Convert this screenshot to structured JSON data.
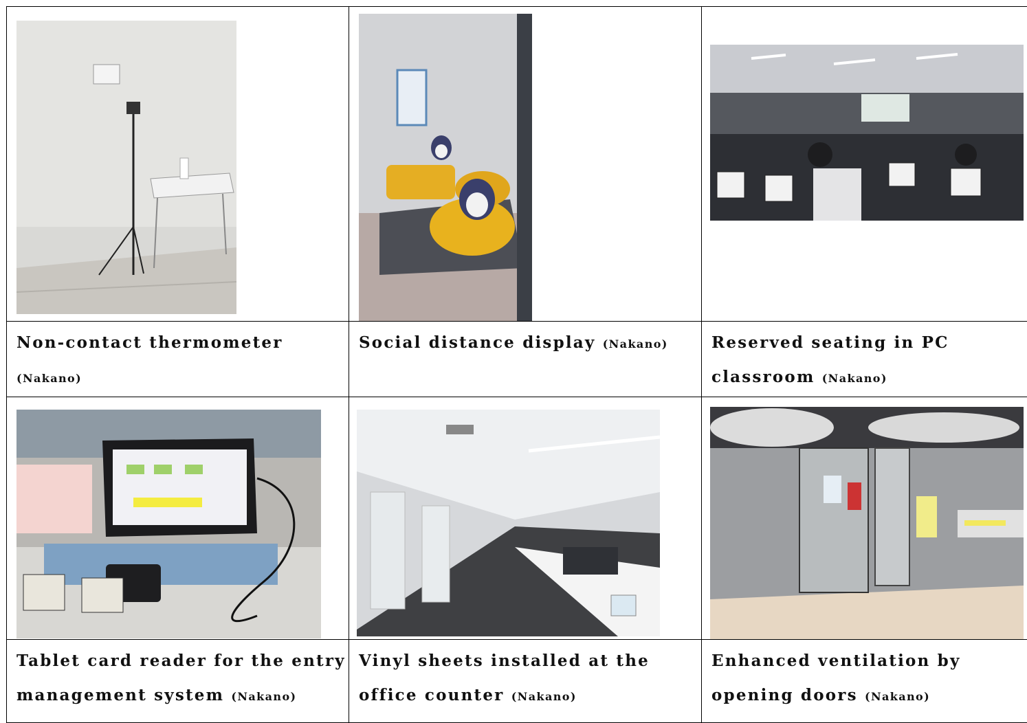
{
  "cells": [
    {
      "caption": "Non-contact thermometer",
      "location": "(Nakano)",
      "photo": "thermometer-photo"
    },
    {
      "caption": "Social distance display",
      "location": "(Nakano)",
      "photo": "social-distance-photo"
    },
    {
      "caption": "Reserved seating in PC classroom",
      "location": "(Nakano)",
      "photo": "pc-classroom-photo"
    },
    {
      "caption": "Tablet card reader for the entry management system",
      "location": "(Nakano)",
      "photo": "tablet-reader-photo"
    },
    {
      "caption": "Vinyl sheets installed at the office counter",
      "location": "(Nakano)",
      "photo": "office-counter-photo"
    },
    {
      "caption": "Enhanced ventilation by opening doors",
      "location": "(Nakano)",
      "photo": "ventilation-photo"
    }
  ],
  "colors": {
    "border": "#000000",
    "text": "#111111"
  }
}
